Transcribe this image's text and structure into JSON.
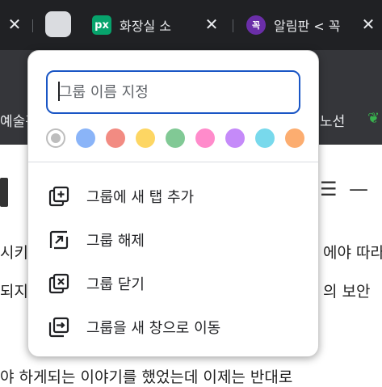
{
  "tabs": [
    {
      "label": "화장실 소",
      "icon": "px-favicon"
    },
    {
      "label": "알림판 < 꼭",
      "icon": "kkok-favicon"
    }
  ],
  "bookmarks": [
    "예술관",
    "노선"
  ],
  "page": {
    "line1_left": "시키",
    "line1_right": "에야 따라",
    "line2_left": "되지",
    "line2_right": "의 보안",
    "line3": "야 하게되는 이야기를 했었는데 이제는 반대로"
  },
  "dialog": {
    "name_placeholder": "그룹 이름 지정",
    "colors": [
      {
        "name": "grey",
        "hex": "#bdbdbd",
        "selected": true
      },
      {
        "name": "blue",
        "hex": "#8ab4f8"
      },
      {
        "name": "red",
        "hex": "#f28b82"
      },
      {
        "name": "yellow",
        "hex": "#fdd663"
      },
      {
        "name": "green",
        "hex": "#81c995"
      },
      {
        "name": "pink",
        "hex": "#ff8bcb"
      },
      {
        "name": "purple",
        "hex": "#c58af9"
      },
      {
        "name": "cyan",
        "hex": "#78d9ec"
      },
      {
        "name": "orange",
        "hex": "#fcad70"
      }
    ],
    "menu": [
      {
        "label": "그룹에 새 탭 추가",
        "icon": "add-tab-icon"
      },
      {
        "label": "그룹 해제",
        "icon": "ungroup-icon"
      },
      {
        "label": "그룹 닫기",
        "icon": "close-group-icon"
      },
      {
        "label": "그룹을 새 창으로 이동",
        "icon": "move-to-window-icon"
      }
    ]
  }
}
